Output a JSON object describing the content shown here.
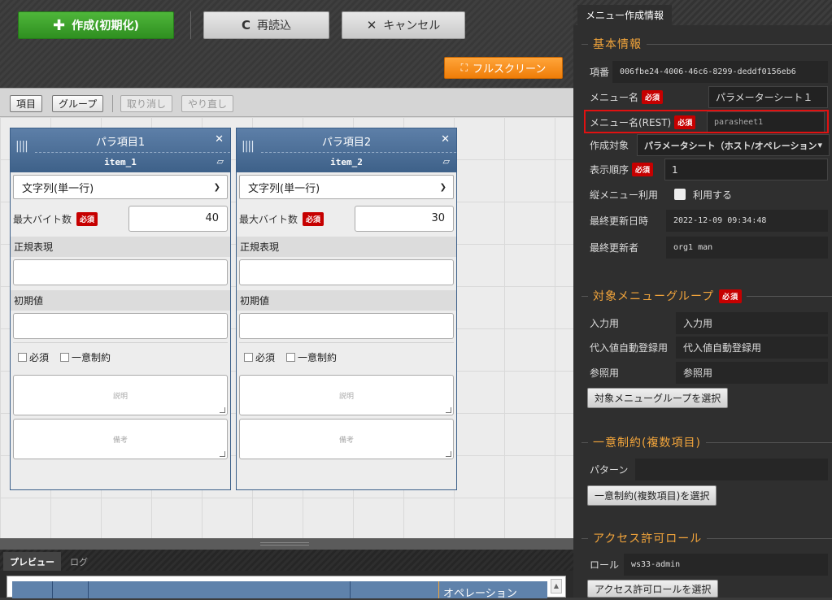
{
  "toolbar": {
    "create_label": "作成(初期化)",
    "reload_label": "再読込",
    "cancel_label": "キャンセル",
    "fullscreen_label": "フルスクリーン"
  },
  "subbar": {
    "item_label": "項目",
    "group_label": "グループ",
    "undo_label": "取り消し",
    "redo_label": "やり直し"
  },
  "cards": [
    {
      "title": "パラ項目1",
      "key": "item_1",
      "type": "文字列(単一行)",
      "max_bytes_label": "最大バイト数",
      "required_badge": "必須",
      "max_bytes": "40",
      "regex_label": "正規表現",
      "initial_label": "初期値",
      "required_label": "必須",
      "unique_label": "一意制約",
      "desc_placeholder": "説明",
      "note_placeholder": "備考"
    },
    {
      "title": "パラ項目2",
      "key": "item_2",
      "type": "文字列(単一行)",
      "max_bytes_label": "最大バイト数",
      "required_badge": "必須",
      "max_bytes": "30",
      "regex_label": "正規表現",
      "initial_label": "初期値",
      "required_label": "必須",
      "unique_label": "一意制約",
      "desc_placeholder": "説明",
      "note_placeholder": "備考"
    }
  ],
  "preview": {
    "tab_preview": "プレビュー",
    "tab_log": "ログ",
    "column_operation": "オペレーション"
  },
  "panel": {
    "tab": "メニュー作成情報",
    "basic_legend": "基本情報",
    "item_no_label": "項番",
    "item_no": "006fbe24-4006-46c6-8299-deddf0156eb6",
    "menu_name_label": "メニュー名",
    "menu_name": "パラメーターシート１",
    "menu_rest_label": "メニュー名(REST)",
    "menu_rest": "parasheet1",
    "target_label": "作成対象",
    "target": "パラメータシート（ホスト/オペレーションあ",
    "order_label": "表示順序",
    "order": "1",
    "vertical_label": "縦メニュー利用",
    "vertical_use": "利用する",
    "updated_at_label": "最終更新日時",
    "updated_at": "2022-12-09 09:34:48",
    "updated_by_label": "最終更新者",
    "updated_by": "org1 man",
    "required": "必須",
    "group_legend": "対象メニューグループ",
    "input_label": "入力用",
    "input_value": "入力用",
    "subst_label": "代入値自動登録用",
    "subst_value": "代入値自動登録用",
    "ref_label": "参照用",
    "ref_value": "参照用",
    "group_select_btn": "対象メニューグループを選択",
    "unique_legend": "一意制約(複数項目)",
    "pattern_label": "パターン",
    "pattern_value": "",
    "unique_select_btn": "一意制約(複数項目)を選択",
    "role_legend": "アクセス許可ロール",
    "role_label": "ロール",
    "role_value": "ws33-admin",
    "role_select_btn": "アクセス許可ロールを選択"
  }
}
